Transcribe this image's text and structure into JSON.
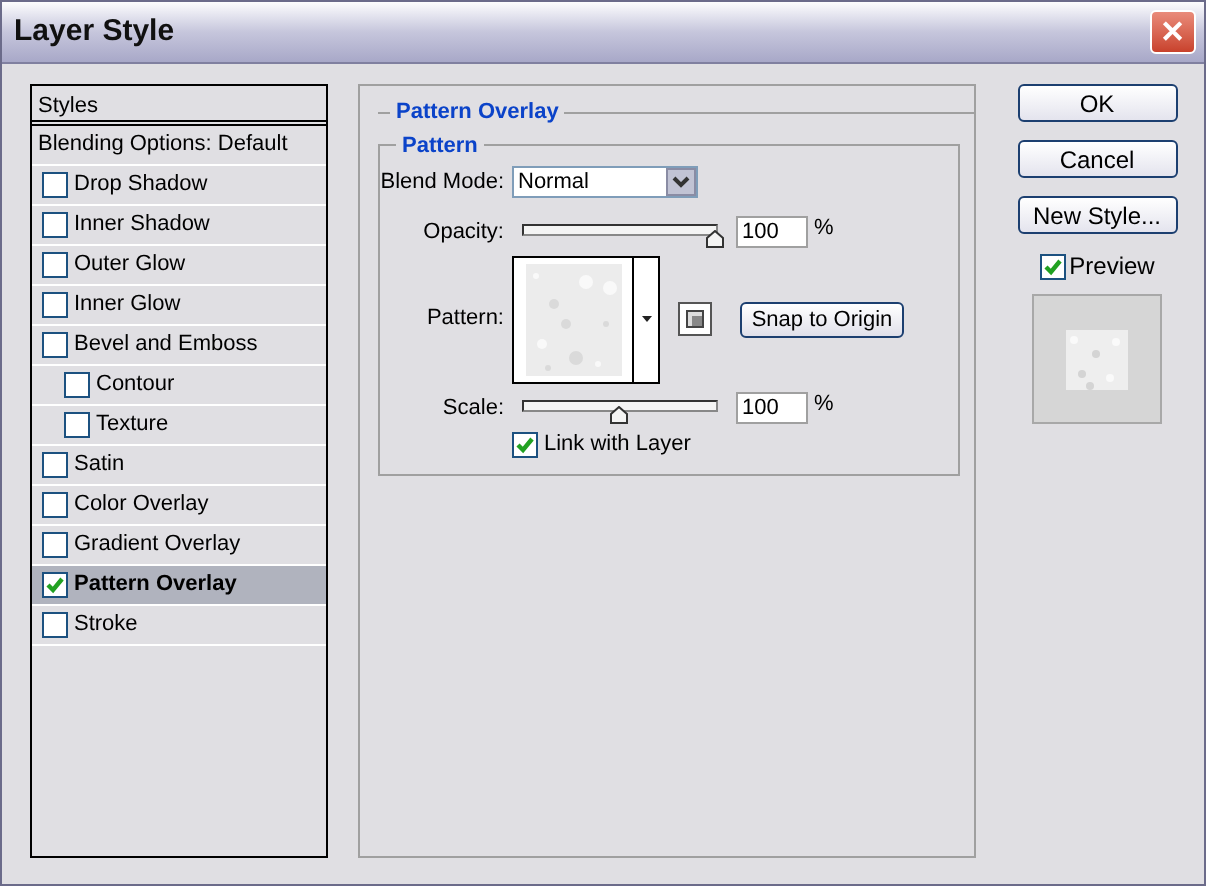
{
  "window": {
    "title": "Layer Style",
    "close": "✕"
  },
  "styles_list": {
    "header": "Styles",
    "items": [
      {
        "kind": "plain",
        "label": "Blending Options: Default",
        "selected": false
      },
      {
        "kind": "effect",
        "label": "Drop Shadow",
        "checked": false,
        "selected": false
      },
      {
        "kind": "effect",
        "label": "Inner Shadow",
        "checked": false,
        "selected": false
      },
      {
        "kind": "effect",
        "label": "Outer Glow",
        "checked": false,
        "selected": false
      },
      {
        "kind": "effect",
        "label": "Inner Glow",
        "checked": false,
        "selected": false
      },
      {
        "kind": "effect",
        "label": "Bevel and Emboss",
        "checked": false,
        "selected": false,
        "children": [
          {
            "kind": "effect",
            "label": "Contour",
            "checked": false,
            "selected": false
          },
          {
            "kind": "effect",
            "label": "Texture",
            "checked": false,
            "selected": false
          }
        ]
      },
      {
        "kind": "effect",
        "label": "Satin",
        "checked": false,
        "selected": false
      },
      {
        "kind": "effect",
        "label": "Color Overlay",
        "checked": false,
        "selected": false
      },
      {
        "kind": "effect",
        "label": "Gradient Overlay",
        "checked": false,
        "selected": false
      },
      {
        "kind": "effect",
        "label": "Pattern Overlay",
        "checked": true,
        "selected": true
      },
      {
        "kind": "effect",
        "label": "Stroke",
        "checked": false,
        "selected": false
      }
    ]
  },
  "panel": {
    "title": "Pattern Overlay",
    "group": "Pattern",
    "blend_mode": {
      "label": "Blend Mode:",
      "value": "Normal"
    },
    "opacity": {
      "label": "Opacity:",
      "level": 1,
      "value": "100",
      "unit": "%"
    },
    "pattern": {
      "label": "Pattern:",
      "snap_button": "Snap to Origin"
    },
    "scale": {
      "label": "Scale:",
      "level": 0.5,
      "value": "100",
      "unit": "%"
    },
    "link_with_layer": {
      "label": "Link with Layer",
      "checked": true
    }
  },
  "buttons": [
    "OK",
    "Cancel",
    "New Style..."
  ],
  "preview": {
    "label": "Preview",
    "checked": true
  }
}
